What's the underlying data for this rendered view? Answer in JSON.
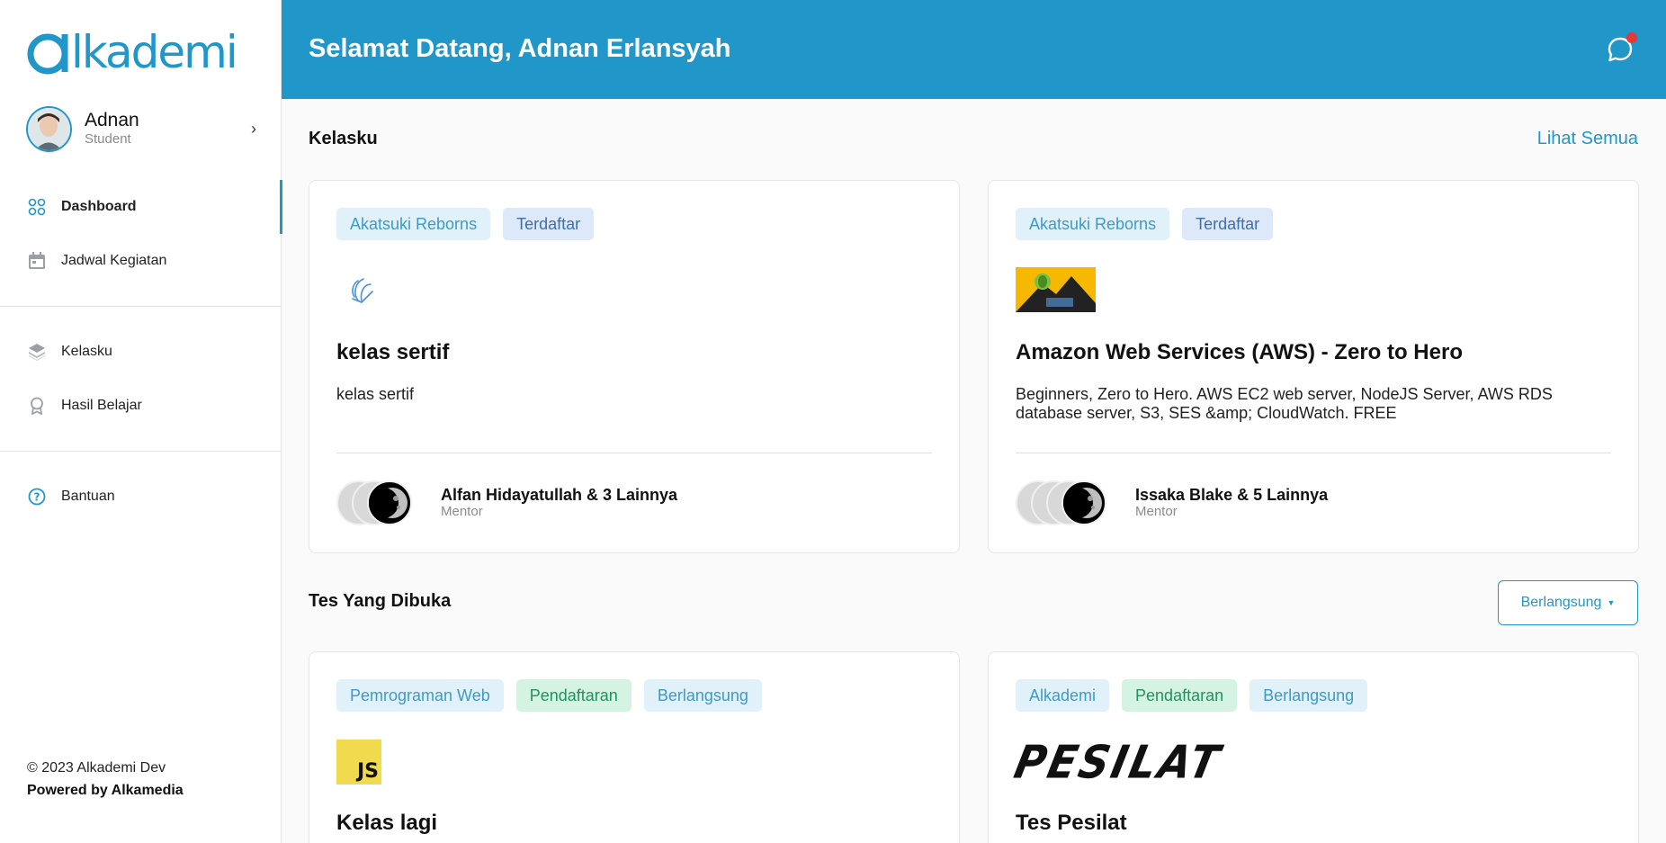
{
  "brand": {
    "logo_text": "lkademi",
    "logo_mark": "α",
    "accent": "#2196c9"
  },
  "profile": {
    "name": "Adnan",
    "role": "Student"
  },
  "nav": {
    "primary": [
      {
        "label": "Dashboard",
        "icon": "grid-icon",
        "active": true
      },
      {
        "label": "Jadwal Kegiatan",
        "icon": "calendar-icon"
      }
    ],
    "secondary": [
      {
        "label": "Kelasku",
        "icon": "layers-icon"
      },
      {
        "label": "Hasil Belajar",
        "icon": "award-icon"
      }
    ],
    "help": [
      {
        "label": "Bantuan",
        "icon": "help-circle-icon"
      }
    ]
  },
  "footer": {
    "copyright": "© 2023 Alkademi Dev",
    "powered": "Powered by Alkamedia"
  },
  "header": {
    "welcome": "Selamat Datang, Adnan Erlansyah",
    "notification_dot": true
  },
  "kelasku": {
    "title": "Kelasku",
    "see_all": "Lihat Semua",
    "cards": [
      {
        "tags": [
          "Akatsuki Reborns",
          "Terdaftar"
        ],
        "thumb": "wave-icon",
        "title": "kelas sertif",
        "desc": "kelas sertif",
        "mentor": "Alfan Hidayatullah & 3 Lainnya",
        "mentor_role": "Mentor"
      },
      {
        "tags": [
          "Akatsuki Reborns",
          "Terdaftar"
        ],
        "thumb": "course-banner-image",
        "title": "Amazon Web Services (AWS) - Zero to Hero",
        "desc": "Beginners, Zero to Hero. AWS EC2 web server, NodeJS Server, AWS RDS database server, S3, SES &amp; CloudWatch. FREE",
        "mentor": "Issaka Blake & 5 Lainnya",
        "mentor_role": "Mentor"
      }
    ]
  },
  "tests": {
    "title": "Tes Yang Dibuka",
    "filter": "Berlangsung",
    "cards": [
      {
        "tags": [
          "Pemrograman Web",
          "Pendaftaran",
          "Berlangsung"
        ],
        "thumb_text": "JS",
        "title": "Kelas lagi"
      },
      {
        "tags": [
          "Alkademi",
          "Pendaftaran",
          "Berlangsung"
        ],
        "thumb_text": "PESILAT",
        "title": "Tes Pesilat"
      }
    ]
  }
}
